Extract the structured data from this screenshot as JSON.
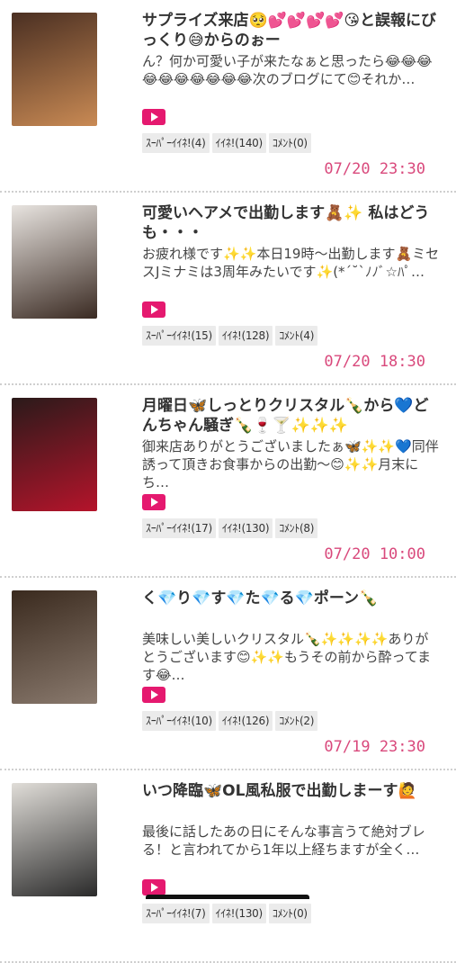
{
  "posts": [
    {
      "title": "サプライズ来店🥺💕💕💕💕😘と誤報にびっくり😅からのぉー",
      "excerpt": "ん？何か可愛い子が来たなぁと思ったら😂😂😂😂😂😂😂😂😂😂次のブログにて😊それか…",
      "super_like": "ｽｰﾊﾟｰｲｲﾈ!(4)",
      "like": "ｲｲﾈ!(140)",
      "comment": "ｺﾒﾝﾄ(0)",
      "time": "07/20 23:30",
      "thumb_colors": [
        "#4a2f22",
        "#c98a54"
      ]
    },
    {
      "title": "可愛いヘアメで出勤します🧸✨ 私はどうも・・・",
      "excerpt": "お疲れ様です✨✨本日19時〜出勤します🧸ミセスJミナミは3周年みたいです✨(*´˘`ﾉﾉﾞ☆ﾊﾟ…",
      "super_like": "ｽｰﾊﾟｰｲｲﾈ!(15)",
      "like": "ｲｲﾈ!(128)",
      "comment": "ｺﾒﾝﾄ(4)",
      "time": "07/20 18:30",
      "thumb_colors": [
        "#e8e4e0",
        "#3a2a22"
      ]
    },
    {
      "title": "月曜日🦋しっとりクリスタル🍾から💙どんちゃん騒ぎ🍾🍷🍸✨✨✨",
      "excerpt": "御来店ありがとうございましたぁ🦋✨✨💙同伴誘って頂きお食事からの出勤〜😊✨✨月末にち…",
      "super_like": "ｽｰﾊﾟｰｲｲﾈ!(17)",
      "like": "ｲｲﾈ!(130)",
      "comment": "ｺﾒﾝﾄ(8)",
      "time": "07/20 10:00",
      "thumb_colors": [
        "#2a1a1a",
        "#b5142b"
      ]
    },
    {
      "title": "く💎り💎す💎た💎る💎ポーン🍾",
      "excerpt": "美味しい美しいクリスタル🍾✨✨✨✨ありがとうございます😊✨✨もうその前から酔ってます😂…",
      "super_like": "ｽｰﾊﾟｰｲｲﾈ!(10)",
      "like": "ｲｲﾈ!(126)",
      "comment": "ｺﾒﾝﾄ(2)",
      "time": "07/19 23:30",
      "thumb_colors": [
        "#3a2a1e",
        "#8a7a6e"
      ]
    },
    {
      "title": "いつ降臨🦋OL風私服で出勤しまーす🙋",
      "excerpt": "最後に話したあの日にそんな事言うて絶対ブレる！と言われてから1年以上経ちますが全く…",
      "super_like": "ｽｰﾊﾟｰｲｲﾈ!(7)",
      "like": "ｲｲﾈ!(130)",
      "comment": "ｺﾒﾝﾄ(0)",
      "time": "",
      "thumb_colors": [
        "#e0ddd8",
        "#2a2a2a"
      ]
    }
  ]
}
